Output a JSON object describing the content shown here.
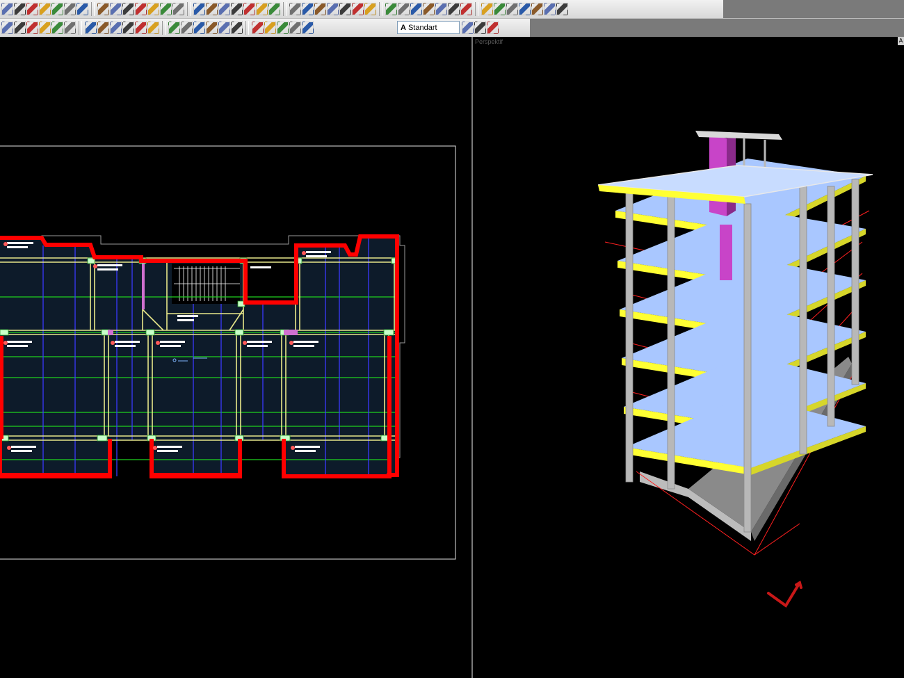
{
  "toolbar": {
    "row1_icons": [
      "zoom-window-icon",
      "zoom-extents-icon",
      "zoom-icon",
      "zoom-all-icon",
      "pan-icon",
      "draw-line-icon",
      "pencil-icon",
      "brush-icon",
      "text-icon",
      "arc-icon",
      "move-icon",
      "rotate-icon",
      "triangle-icon",
      "column-icon",
      "grid-icon",
      "trim-icon",
      "extend-icon",
      "intersect-icon",
      "cross-icon",
      "offset-icon",
      "fillet-icon",
      "chamfer-icon",
      "select-icon",
      "dim-linear-icon",
      "dim-angle-icon",
      "beam-icon",
      "slab-icon",
      "wall-icon",
      "stair-icon",
      "snap-icon",
      "ortho-icon",
      "polar-icon",
      "osnap-icon",
      "layer-icon",
      "light-icon",
      "lock-icon",
      "mesh-icon",
      "cut-icon",
      "properties-icon",
      "lightning-icon",
      "report-icon",
      "table-icon"
    ],
    "row2_icons": [
      "rebar-icon",
      "stirrup-icon",
      "footing-icon",
      "pile-icon",
      "beam-section-icon",
      "column-section-icon",
      "section-cut-icon",
      "elevation-icon",
      "detail-icon",
      "load-icon",
      "analysis-icon",
      "results-icon",
      "design-icon",
      "drawing-icon",
      "print-icon",
      "text-style-icon",
      "arc-tool-icon",
      "circle-tool-icon",
      "rect-tool-icon",
      "hatch-icon",
      "table-tool-icon",
      "block-icon",
      "layer-props-icon"
    ],
    "text_style_prefix": "A",
    "text_style_value": "Standart",
    "row2_tail_icons": [
      "dropdown-icon",
      "measure-icon",
      "window-icon"
    ]
  },
  "left_viewport": {
    "label": "",
    "colors": {
      "outline": "#ff0000",
      "beam": "#e8e88a",
      "axis_green": "#1fd11f",
      "axis_blue": "#3a3aff",
      "slab": "#0d1b2a",
      "frame": "#bdbdbd"
    }
  },
  "right_viewport": {
    "label": "Perspektif",
    "corner_label": "A",
    "colors": {
      "slab": "#a9c7ff",
      "beam": "#ffff33",
      "column": "#b8b8b8",
      "shaft": "#cc44cc",
      "edge": "#ff2020",
      "base": "#9e9e9e"
    }
  }
}
